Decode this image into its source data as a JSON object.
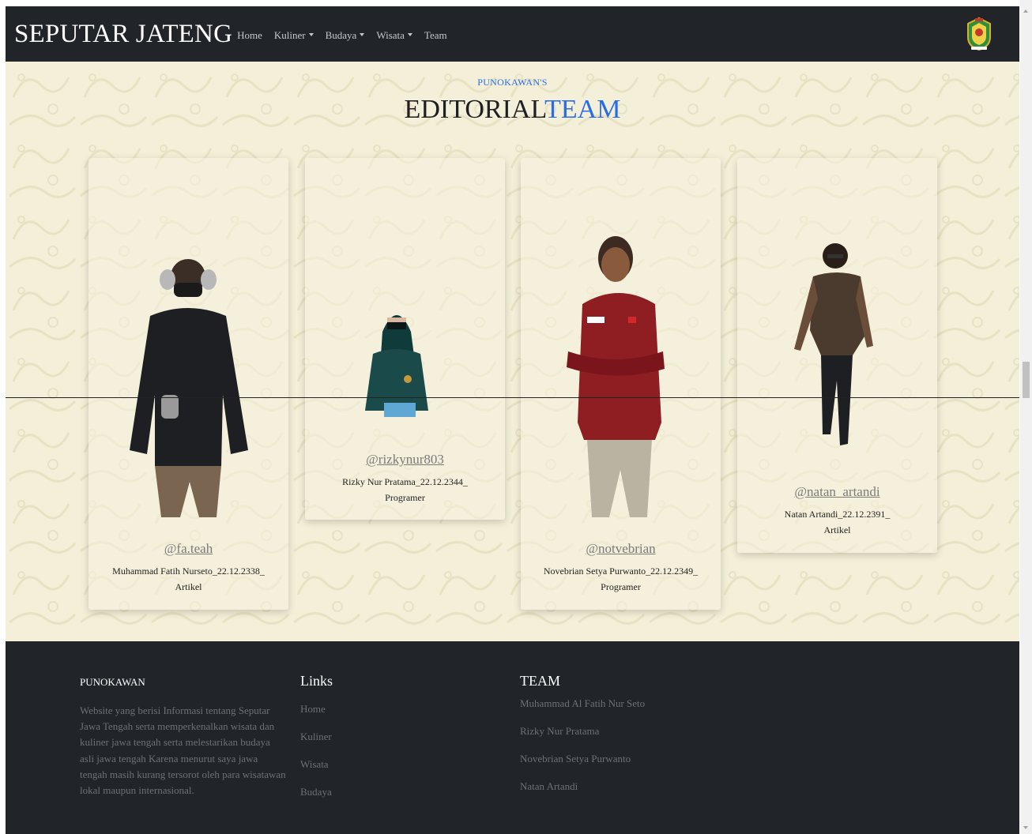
{
  "navbar": {
    "brand": "SEPUTAR JATENG",
    "links": [
      {
        "label": "Home",
        "dropdown": false
      },
      {
        "label": "Kuliner",
        "dropdown": true
      },
      {
        "label": "Budaya",
        "dropdown": true
      },
      {
        "label": "Wisata",
        "dropdown": true
      },
      {
        "label": "Team",
        "dropdown": false
      }
    ],
    "emblem_icon": "central-java-emblem-icon"
  },
  "section": {
    "kicker": "PUNOKAWAN'S",
    "title_main": "EDITORIAL",
    "title_accent": "TEAM",
    "colors": {
      "accent": "#2a6ce8",
      "background": "#f3efd8"
    }
  },
  "team": [
    {
      "handle": "@fa.teah",
      "line1": "Muhammad Fatih Nurseto_22.12.2338_",
      "line2": "Artikel",
      "icon": "person-photo-icon"
    },
    {
      "handle": "@rizkynur803",
      "line1": "Rizky Nur Pratama_22.12.2344_",
      "line2": "Programer",
      "icon": "person-photo-icon"
    },
    {
      "handle": "@notvebrian",
      "line1": "Novebrian Setya Purwanto_22.12.2349_",
      "line2": "Programer",
      "icon": "person-photo-icon"
    },
    {
      "handle": "@natan_artandi",
      "line1": "Natan Artandi_22.12.2391_",
      "line2": "Artikel",
      "icon": "person-photo-icon"
    }
  ],
  "footer": {
    "about_title": "PUNOKAWAN",
    "about_text": "Website yang berisi Informasi tentang Seputar Jawa Tengah serta memperkenalkan wisata dan kuliner jawa tengah serta melestarikan budaya asli jawa tengah Karena menurut saya jawa tengah masih kurang tersorot oleh para wisatawan lokal maupun internasional.",
    "links_title": "Links",
    "links": [
      "Home",
      "Kuliner",
      "Wisata",
      "Budaya"
    ],
    "team_title": "TEAM",
    "team": [
      "Muhammad Al Fatih Nur Seto",
      "Rizky Nur Pratama",
      "Novebrian Setya Purwanto",
      "Natan Artandi"
    ],
    "colors": {
      "background": "#212529",
      "muted_text": "#6d7177"
    }
  }
}
